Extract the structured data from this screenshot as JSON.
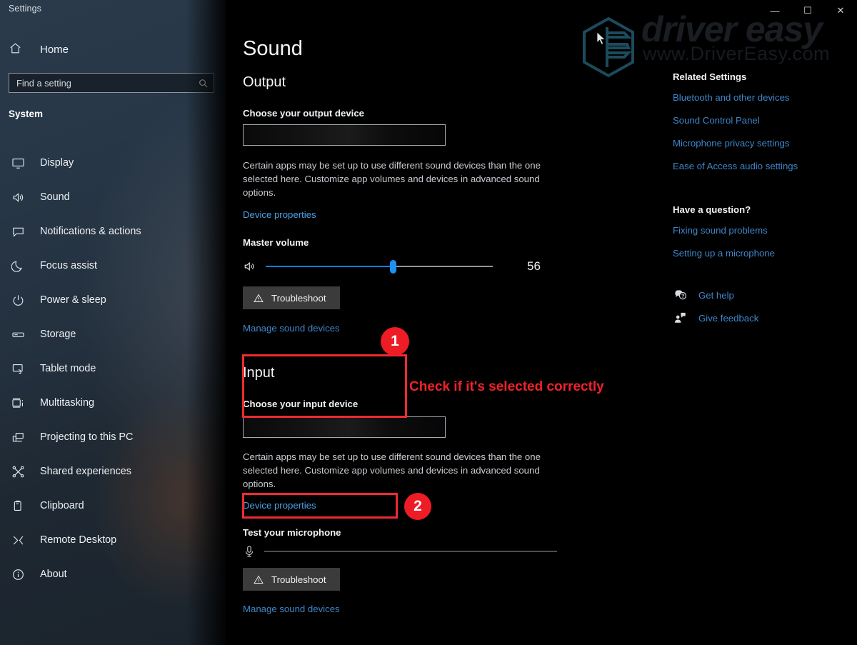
{
  "window": {
    "title": "Settings",
    "controls": [
      {
        "name": "minimize",
        "glyph": "—"
      },
      {
        "name": "maximize",
        "glyph": "☐"
      },
      {
        "name": "close",
        "glyph": "✕"
      }
    ]
  },
  "watermark": {
    "brand": "driver easy",
    "url": "www.DriverEasy.com",
    "logo_color": "#1b4b5c"
  },
  "sidebar": {
    "home_label": "Home",
    "home_icon": "home-icon",
    "search": {
      "placeholder": "Find a setting",
      "icon": "search-icon"
    },
    "section_title": "System",
    "items": [
      {
        "label": "Display",
        "icon": "monitor-icon"
      },
      {
        "label": "Sound",
        "icon": "speaker-icon"
      },
      {
        "label": "Notifications & actions",
        "icon": "chat-bubble-icon"
      },
      {
        "label": "Focus assist",
        "icon": "moon-icon"
      },
      {
        "label": "Power & sleep",
        "icon": "power-icon"
      },
      {
        "label": "Storage",
        "icon": "drive-icon"
      },
      {
        "label": "Tablet mode",
        "icon": "tablet-icon"
      },
      {
        "label": "Multitasking",
        "icon": "multitask-icon"
      },
      {
        "label": "Projecting to this PC",
        "icon": "project-icon"
      },
      {
        "label": "Shared experiences",
        "icon": "share-icon"
      },
      {
        "label": "Clipboard",
        "icon": "clipboard-icon"
      },
      {
        "label": "Remote Desktop",
        "icon": "remote-desktop-icon"
      },
      {
        "label": "About",
        "icon": "info-icon"
      }
    ]
  },
  "main": {
    "page_title": "Sound",
    "output": {
      "heading": "Output",
      "choose_label": "Choose your output device",
      "device_value": "",
      "note": "Certain apps may be set up to use different sound devices than the one selected here. Customize app volumes and devices in advanced sound options.",
      "device_properties_link": "Device properties",
      "volume_label": "Master volume",
      "volume_value": "56",
      "volume_percent": 56,
      "volume_icon": "speaker-icon",
      "troubleshoot_label": "Troubleshoot",
      "troubleshoot_icon": "warning-triangle-icon",
      "manage_link": "Manage sound devices"
    },
    "input": {
      "heading": "Input",
      "choose_label": "Choose your input device",
      "device_value": "",
      "note": "Certain apps may be set up to use different sound devices than the one selected here. Customize app volumes and devices in advanced sound options.",
      "device_properties_link": "Device properties",
      "test_label": "Test your microphone",
      "test_icon": "microphone-icon",
      "test_level_percent": 0,
      "troubleshoot_label": "Troubleshoot",
      "troubleshoot_icon": "warning-triangle-icon",
      "manage_link": "Manage sound devices"
    }
  },
  "right_panel": {
    "related_heading": "Related Settings",
    "related_links": [
      "Bluetooth and other devices",
      "Sound Control Panel",
      "Microphone privacy settings",
      "Ease of Access audio settings"
    ],
    "question_heading": "Have a question?",
    "question_links": [
      "Fixing sound problems",
      "Setting up a microphone"
    ],
    "help_items": [
      {
        "label": "Get help",
        "icon": "help-bubble-icon"
      },
      {
        "label": "Give feedback",
        "icon": "feedback-person-icon"
      }
    ]
  },
  "annotations": {
    "accent_color": "#ee1c25",
    "badge_1": "1",
    "badge_2": "2",
    "callout_text": "Check if it's selected correctly"
  }
}
